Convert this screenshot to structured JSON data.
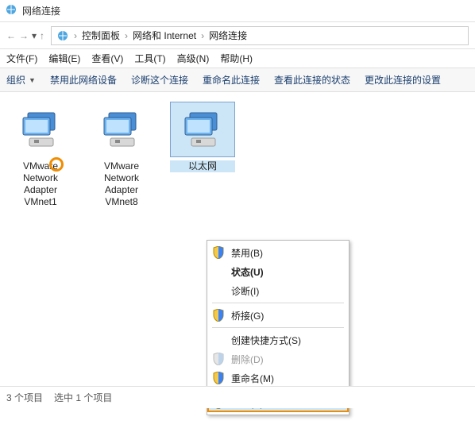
{
  "titlebar": {
    "title": "网络连接"
  },
  "breadcrumb": {
    "items": [
      "控制面板",
      "网络和 Internet",
      "网络连接"
    ]
  },
  "nav": {
    "back": "←",
    "forward": "→",
    "up": "↑"
  },
  "menubar": {
    "file": "文件(F)",
    "edit": "编辑(E)",
    "view": "查看(V)",
    "tools": "工具(T)",
    "advanced": "高级(N)",
    "help": "帮助(H)"
  },
  "toolbar": {
    "organize": "组织",
    "disable": "禁用此网络设备",
    "diagnose": "诊断这个连接",
    "rename": "重命名此连接",
    "status": "查看此连接的状态",
    "change": "更改此连接的设置"
  },
  "adapters": [
    {
      "label": "VMware Network Adapter VMnet1",
      "selected": false
    },
    {
      "label": "VMware Network Adapter VMnet8",
      "selected": false
    },
    {
      "label": "以太网",
      "selected": true
    }
  ],
  "context_menu": {
    "disable": "禁用(B)",
    "status": "状态(U)",
    "diagnose": "诊断(I)",
    "bridge": "桥接(G)",
    "shortcut": "创建快捷方式(S)",
    "delete": "删除(D)",
    "rename": "重命名(M)",
    "properties": "属性(R)"
  },
  "statusbar": {
    "count": "3 个项目",
    "selected": "选中 1 个项目"
  }
}
